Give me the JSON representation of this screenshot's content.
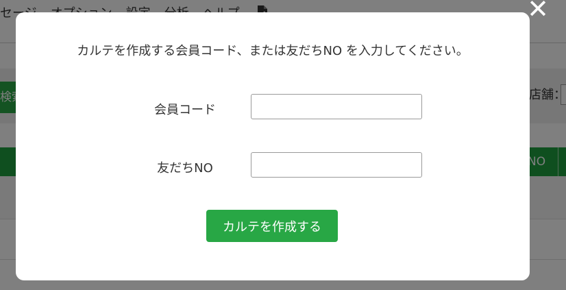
{
  "menubar": {
    "items": [
      "セージ",
      "オプション",
      "設定",
      "分析",
      "ヘルプ"
    ],
    "export_icon": "export-icon"
  },
  "search": {
    "button_label": "検索"
  },
  "store": {
    "label": "店舗："
  },
  "table": {
    "header_last_col": "NO"
  },
  "modal": {
    "message": "カルテを作成する会員コード、または友だちNO を入力してください。",
    "close_icon": "close-icon",
    "member_code_label": "会員コード",
    "member_code_value": "",
    "friend_no_label": "友だちNO",
    "friend_no_value": "",
    "create_button_label": "カルテを作成する"
  },
  "colors": {
    "accent_green": "#28a745",
    "table_header_green": "#1e9e3e",
    "overlay": "rgba(0,0,0,0.5)"
  }
}
